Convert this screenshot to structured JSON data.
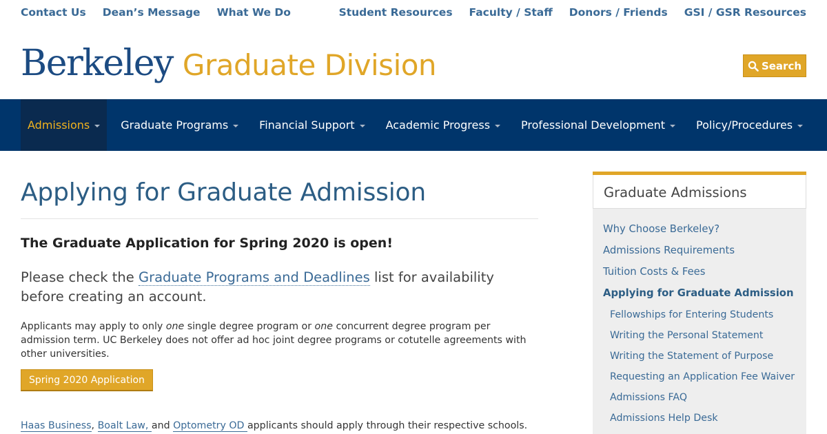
{
  "utility": {
    "left": [
      "Contact Us",
      "Dean’s Message",
      "What We Do"
    ],
    "right": [
      "Student Resources",
      "Faculty / Staff",
      "Donors / Friends",
      "GSI / GSR Resources"
    ]
  },
  "header": {
    "logo_berkeley": "Berkeley",
    "logo_division": "Graduate Division",
    "search_label": "Search"
  },
  "nav": [
    {
      "label": "Admissions",
      "active": true
    },
    {
      "label": "Graduate Programs"
    },
    {
      "label": "Financial Support"
    },
    {
      "label": "Academic Progress"
    },
    {
      "label": "Professional Development"
    },
    {
      "label": "Policy/Procedures"
    }
  ],
  "main": {
    "title": "Applying for Graduate Admission",
    "announcement": "The Graduate Application for Spring 2020 is open!",
    "lead_before": "Please check the ",
    "lead_link": "Graduate Programs and Deadlines",
    "lead_after": " list for availability before creating an account.",
    "body_1": "Applicants may apply to only ",
    "body_em_1": "one",
    "body_2": " single degree program or ",
    "body_em_2": "one",
    "body_3": " concurrent degree program per admission term. UC Berkeley does not offer ad hoc joint degree programs or cotutelle agreements with other universities.",
    "apply_button": "Spring 2020 Application",
    "school_1": "Haas Business",
    "sep_1": ", ",
    "school_2": "Boalt Law, ",
    "sep_2": " and ",
    "school_3": "Optometry OD ",
    "schools_after": " applicants should apply through their respective schools."
  },
  "sidebar": {
    "title": "Graduate Admissions",
    "links": [
      "Why Choose Berkeley?",
      "Admissions Requirements",
      "Tuition Costs & Fees"
    ],
    "current": "Applying for Graduate Admission",
    "sublinks": [
      "Fellowships for Entering Students",
      "Writing the Personal Statement",
      "Writing the Statement of Purpose",
      "Requesting an Application Fee Waiver",
      "Admissions FAQ",
      "Admissions Help Desk"
    ]
  },
  "colors": {
    "navy": "#00356b",
    "gold": "#e0a628",
    "link": "#3a6a96"
  },
  "icons": [
    "search-icon",
    "caret-down-icon"
  ]
}
